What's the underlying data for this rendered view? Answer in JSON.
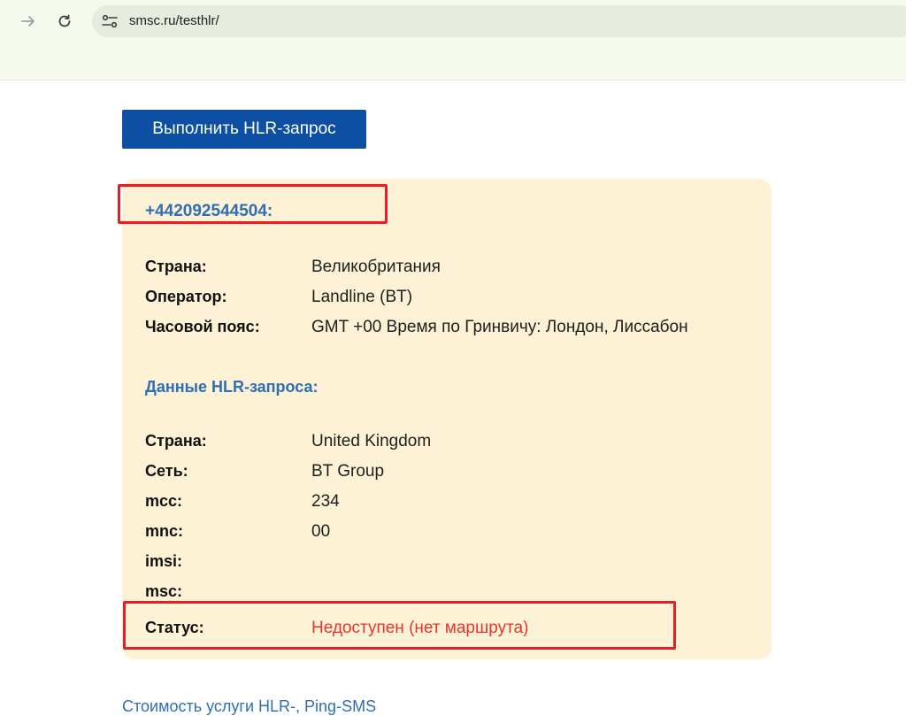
{
  "browser": {
    "url": "smsc.ru/testhlr/"
  },
  "actions": {
    "hlr_button_label": "Выполнить HLR-запрос"
  },
  "result": {
    "phone": "+442092544504:",
    "number_info": [
      {
        "label": "Страна:",
        "value": "Великобритания"
      },
      {
        "label": "Оператор:",
        "value": "Landline (BT)"
      },
      {
        "label": "Часовой пояс:",
        "value": "GMT +00 Время по Гринвичу: Лондон, Лиссабон"
      }
    ],
    "hlr_title": "Данные HLR-запроса:",
    "hlr_info": [
      {
        "label": "Страна:",
        "value": "United Kingdom"
      },
      {
        "label": "Сеть:",
        "value": "BT Group"
      },
      {
        "label": "mcc:",
        "value": "234"
      },
      {
        "label": "mnc:",
        "value": "00"
      },
      {
        "label": "imsi:",
        "value": ""
      },
      {
        "label": "msc:",
        "value": ""
      }
    ],
    "status": {
      "label": "Статус:",
      "value": "Недоступен (нет маршрута)"
    }
  },
  "footer": {
    "link_text": "Стоимость услуги HLR-, Ping-SMS"
  },
  "colors": {
    "button": "#0c4fa3",
    "card": "#fdf2d6",
    "heading": "#2f6eb3",
    "status_error": "#e8342c",
    "annotation": "#ec1c24"
  },
  "icons": {
    "forward": "arrow-right",
    "reload": "reload",
    "site_info": "tune-sliders"
  }
}
